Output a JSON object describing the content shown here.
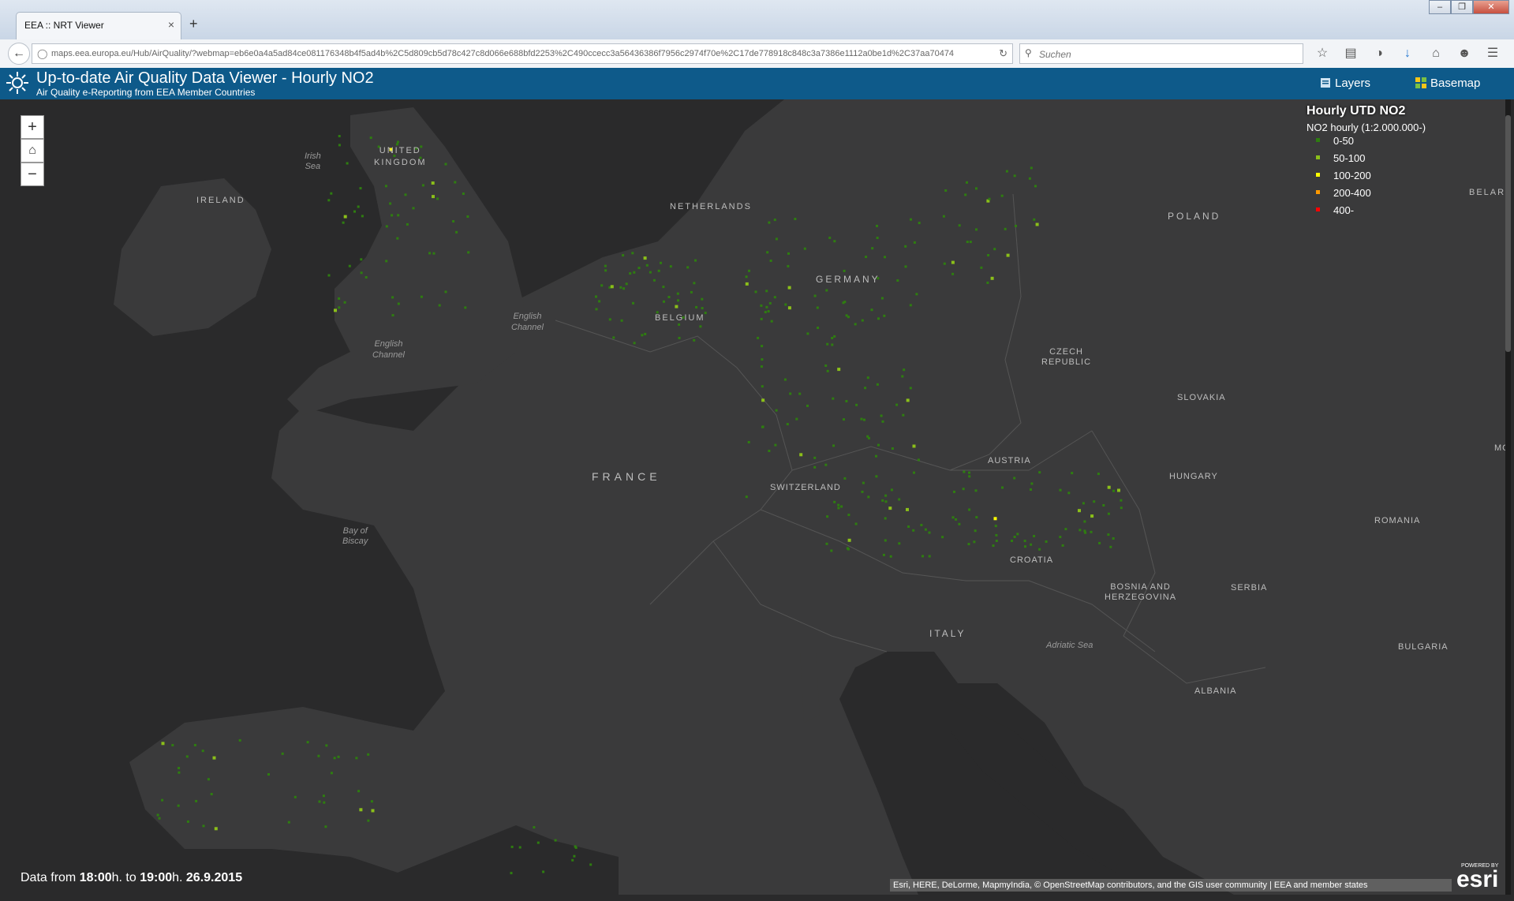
{
  "browser": {
    "tab_title": "EEA :: NRT Viewer",
    "tab_close": "×",
    "new_tab": "+",
    "window_controls": [
      "–",
      "❐",
      "✕"
    ],
    "url": "maps.eea.europa.eu/Hub/AirQuality/?webmap=eb6e0a4a5ad84ce081176348b4f5ad4b%2C5d809cb5d78c427c8d066e688bfd2253%2C490ccecc3a56436386f7956c2974f70e%2C17de778918c848c3a7386e1112a0be1d%2C37aa70474",
    "search_placeholder": "Suchen",
    "toolbar_icons": [
      "star-icon",
      "reading-list-icon",
      "pocket-icon",
      "download-icon",
      "home-icon",
      "chat-icon",
      "menu-icon"
    ]
  },
  "app": {
    "title": "Up-to-date Air Quality Data Viewer - Hourly NO2",
    "subtitle": "Air Quality e-Reporting from EEA Member Countries",
    "layers_label": "Layers",
    "basemap_label": "Basemap",
    "header_color": "#0e5a8a"
  },
  "map": {
    "zoom_in": "+",
    "home": "⌂",
    "zoom_out": "−",
    "legend": {
      "title": "Hourly UTD NO2",
      "subtitle": "NO2 hourly (1:2.000.000-)",
      "classes": [
        {
          "label": "0-50",
          "color": "#2e7d10"
        },
        {
          "label": "50-100",
          "color": "#8bbf1a"
        },
        {
          "label": "100-200",
          "color": "#ffff00"
        },
        {
          "label": "200-400",
          "color": "#ff9900"
        },
        {
          "label": "400-",
          "color": "#ff0000"
        }
      ]
    },
    "labels": {
      "united_kingdom": "UNITED\nKINGDOM",
      "ireland": "IRELAND",
      "netherlands": "NETHERLANDS",
      "belgium": "BELGIUM",
      "germany": "GERMANY",
      "poland": "POLAND",
      "czech": "CZECH\nREPUBLIC",
      "slovakia": "SLOVAKIA",
      "austria": "AUSTRIA",
      "hungary": "HUNGARY",
      "switzerland": "SWITZERLAND",
      "france": "FRANCE",
      "romania": "ROMANIA",
      "croatia": "CROATIA",
      "bosnia": "BOSNIA AND\nHERZEGOVINA",
      "serbia": "SERBIA",
      "italy": "ITALY",
      "bulgaria": "BULGARIA",
      "albania": "ALBANIA",
      "belarus": "BELAR",
      "moldova": "MO"
    },
    "sea_labels": {
      "irish_sea": "Irish\nSea",
      "english_channel_1": "English\nChannel",
      "english_channel_2": "English\nChannel",
      "bay_of_biscay": "Bay of\nBiscay",
      "adriatic": "Adriatic Sea"
    },
    "data_time": {
      "prefix": "Data from ",
      "start": "18:00",
      "mid": "h. to ",
      "end": "19:00",
      "suffix": "h. ",
      "date": "26.9.2015"
    },
    "attribution": "Esri, HERE, DeLorme, MapmyIndia, © OpenStreetMap contributors, and the GIS user community | EEA and member states",
    "esri_powered": "POWERED BY",
    "esri_word": "esri"
  }
}
